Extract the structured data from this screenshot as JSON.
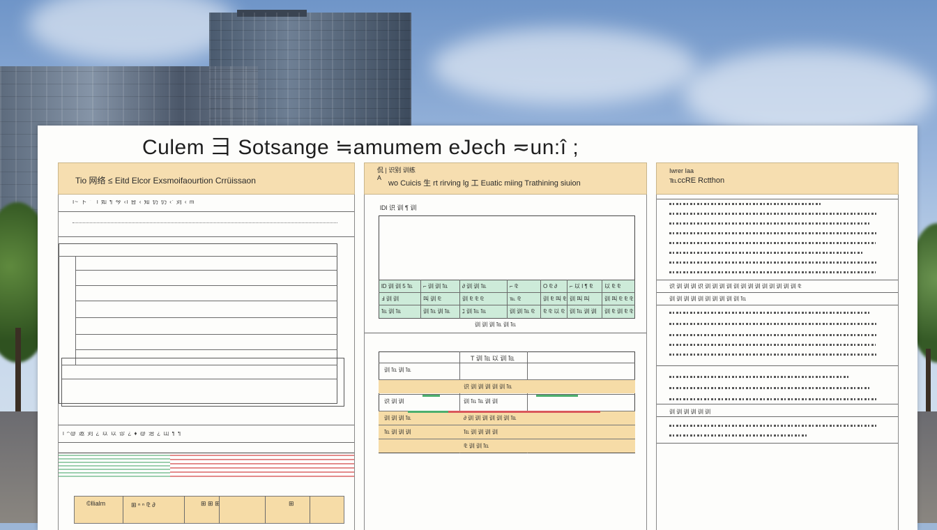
{
  "poster": {
    "title": "Culem 彐 Sotsange ≒amumem eJech ≂un:î ;"
  },
  "left_panel": {
    "header": "Tio 网络 ≤ Eitd  Elcor Exsmoifaourtion  Crrüissaon",
    "lines": [
      "I~ 卜 ˉ ´l 如 ¶ 今 ‹l 台 ‹ 知 仍 仍 ‹' 刘 ‹  m"
    ],
    "footer_line": "l ^@ 邀 刘 ¿ 以 以 诊 ¿ ♦ @ 治 ¿ 山 ¶ ¶",
    "bottom_boxes": [
      "©llialm",
      "⊞ ⁿ ⁿ ⅊ ∂",
      "⊞ ⊞ ⊞",
      "⊞"
    ]
  },
  "middle_panel": {
    "header_sub_1": "侃 | 识别 训练",
    "header_sub_2": "A",
    "header": "wo Cuicis 生 rt rirving  lg 工 Euatic  miing  Trathining  siuion",
    "chart_label": "lDl 识 训 ¶ 训",
    "table1": [
      [
        "lD 训 训 5 ℡",
        "⌐ 训 训 ℡",
        "∂ 训 训 ℡",
        "⌐ ⅊",
        "O ⅊ ∂",
        "⌐ 以 I ¶ ⅊",
        "以 ⅊ ⅊"
      ],
      [
        "Ⅎ 训 训",
        "叫 训 ⅊",
        "训 ⅊ ⅊ ⅊",
        "℡ ⅊",
        "训 ⅊ 叫 ⅊",
        "训 叫 叫",
        "训 叫 ⅊ ⅊ ⅊ ℡ ⅊ ℡ ⅊ ⅊ ⅊"
      ],
      [
        "℡ 训 ℡",
        "训 ℡ 训 ℡",
        "ℷ 训 ℡ ℡",
        "训 训 ℡ ⅊",
        "⅊ ⅊ 以 ⅊",
        "训 ℡ 训 训",
        "训 ⅊ 训 ⅊ ⅊"
      ]
    ],
    "table1_caption": "训 训 训 ℡ 训 ℡",
    "table2_title": "T 训 ℡ 以 训 ℡",
    "table2": [
      [
        "训 ℡ 训 ℡",
        ""
      ],
      [
        "",
        "识 训 训 训 训 训 ℡"
      ],
      [
        "识 训 训",
        "训 ℡ ℡ 训 训"
      ],
      [
        "训 训 训 ℡",
        "∂ 训 训 训 训 训 训 ℡"
      ],
      [
        "℡ 训 训 训",
        "℡ 训 训 训 训"
      ],
      [
        "",
        "⅊ 训 训 ℡"
      ]
    ]
  },
  "right_panel": {
    "header_sub": "Iwrer Iaa",
    "header": "℡ccRE Rctthon",
    "sections": [
      "识 训 训 训 识 训 训 训 训 训 训 训 训 训 训 训 训 训 ⅊",
      "训 训 训 训 训 训 训 训 训 训 ℡",
      "训 训 训 训 训 训"
    ]
  },
  "colors": {
    "header_bg": "#f6deb0",
    "green_cells": "#cdebd9",
    "orange_cells": "#f6dca7",
    "red_bar": "#d9585b",
    "green_bar": "#4caf6e"
  }
}
